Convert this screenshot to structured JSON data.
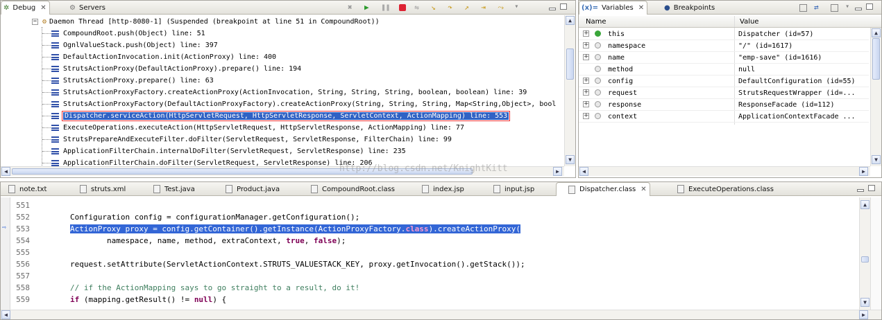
{
  "debug_view": {
    "tab_label": "Debug",
    "servers_tab_label": "Servers",
    "thread_label": "Daemon Thread [http-8080-1] (Suspended (breakpoint at line 51 in CompoundRoot))",
    "frames": [
      "CompoundRoot.push(Object) line: 51",
      "OgnlValueStack.push(Object) line: 397",
      "DefaultActionInvocation.init(ActionProxy) line: 400",
      "StrutsActionProxy(DefaultActionProxy).prepare() line: 194",
      "StrutsActionProxy.prepare() line: 63",
      "StrutsActionProxyFactory.createActionProxy(ActionInvocation, String, String, String, boolean, boolean) line: 39",
      "StrutsActionProxyFactory(DefaultActionProxyFactory).createActionProxy(String, String, String, Map<String,Object>, bool",
      "Dispatcher.serviceAction(HttpServletRequest, HttpServletResponse, ServletContext, ActionMapping) line: 553",
      "ExecuteOperations.executeAction(HttpServletRequest, HttpServletResponse, ActionMapping) line: 77",
      "StrutsPrepareAndExecuteFilter.doFilter(ServletRequest, ServletResponse, FilterChain) line: 99",
      "ApplicationFilterChain.internalDoFilter(ServletRequest, ServletResponse) line: 235",
      "ApplicationFilterChain.doFilter(ServletRequest, ServletResponse) line: 206"
    ],
    "selected_frame_index": 7,
    "watermark": "http://blog.csdn.net/KnightKitt"
  },
  "variables_view": {
    "tab_label": "Variables",
    "breakpoints_tab_label": "Breakpoints",
    "col_name": "Name",
    "col_value": "Value",
    "rows": [
      {
        "expand": "+",
        "name": "this",
        "value": "Dispatcher  (id=57)",
        "icon": "green-dot-icon"
      },
      {
        "expand": "+",
        "name": "namespace",
        "value": "\"/\" (id=1617)",
        "icon": "field-icon"
      },
      {
        "expand": "+",
        "name": "name",
        "value": "\"emp-save\" (id=1616)",
        "icon": "field-icon"
      },
      {
        "expand": "",
        "name": "method",
        "value": "null",
        "icon": "field-icon"
      },
      {
        "expand": "+",
        "name": "config",
        "value": "DefaultConfiguration  (id=55)",
        "icon": "field-icon"
      },
      {
        "expand": "+",
        "name": "request",
        "value": "StrutsRequestWrapper  (id=...",
        "icon": "field-icon"
      },
      {
        "expand": "+",
        "name": "response",
        "value": "ResponseFacade  (id=112)",
        "icon": "field-icon"
      },
      {
        "expand": "+",
        "name": "context",
        "value": "ApplicationContextFacade  ...",
        "icon": "field-icon"
      }
    ]
  },
  "editor": {
    "tabs": [
      {
        "label": "note.txt",
        "active": false
      },
      {
        "label": "struts.xml",
        "active": false
      },
      {
        "label": "Test.java",
        "active": false
      },
      {
        "label": "Product.java",
        "active": false
      },
      {
        "label": "CompoundRoot.class",
        "active": false
      },
      {
        "label": "index.jsp",
        "active": false
      },
      {
        "label": "input.jsp",
        "active": false
      },
      {
        "label": "Dispatcher.class",
        "active": true
      },
      {
        "label": "ExecuteOperations.class",
        "active": false
      }
    ],
    "lines": [
      {
        "num": "551",
        "code": ""
      },
      {
        "num": "552",
        "code": "        Configuration config = configurationManager.getConfiguration();"
      },
      {
        "num": "553",
        "code": "        ActionProxy proxy = config.getContainer().getInstance(ActionProxyFactory.class).createActionProxy("
      },
      {
        "num": "554",
        "code": "                namespace, name, method, extraContext, true, false);"
      },
      {
        "num": "555",
        "code": ""
      },
      {
        "num": "556",
        "code": "        request.setAttribute(ServletActionContext.STRUTS_VALUESTACK_KEY, proxy.getInvocation().getStack());"
      },
      {
        "num": "557",
        "code": ""
      },
      {
        "num": "558",
        "code": "        // if the ActionMapping says to go straight to a result, do it!"
      },
      {
        "num": "559",
        "code": "        if (mapping.getResult() != null) {"
      }
    ],
    "current_line_index": 2
  },
  "colors": {
    "selection": "#3062c4",
    "breakpoint_box": "#e33333",
    "keyword": "#7f0055",
    "comment": "#3f7f5f"
  }
}
